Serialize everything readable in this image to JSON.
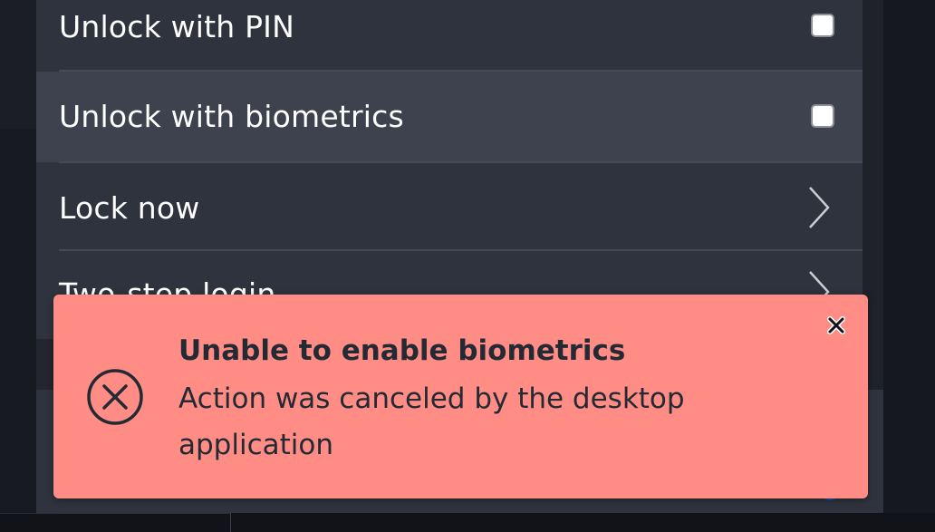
{
  "settings": {
    "rows": [
      {
        "label": "Unlock with PIN",
        "control": "checkbox",
        "checked": false,
        "highlighted": false
      },
      {
        "label": "Unlock with biometrics",
        "control": "checkbox",
        "checked": false,
        "highlighted": true
      },
      {
        "label": "Lock now",
        "control": "chevron"
      },
      {
        "label": "Two-step login",
        "control": "chevron"
      }
    ]
  },
  "toast": {
    "type": "error",
    "icon": "error-circle-icon",
    "title": "Unable to enable biometrics",
    "message": "Action was canceled by the desktop application",
    "close_icon": "close-icon"
  },
  "colors": {
    "popup_bg": "#2f333d",
    "row_highlight": "#3d424e",
    "toast_bg": "#ff8c85",
    "toast_text": "#242a33"
  }
}
